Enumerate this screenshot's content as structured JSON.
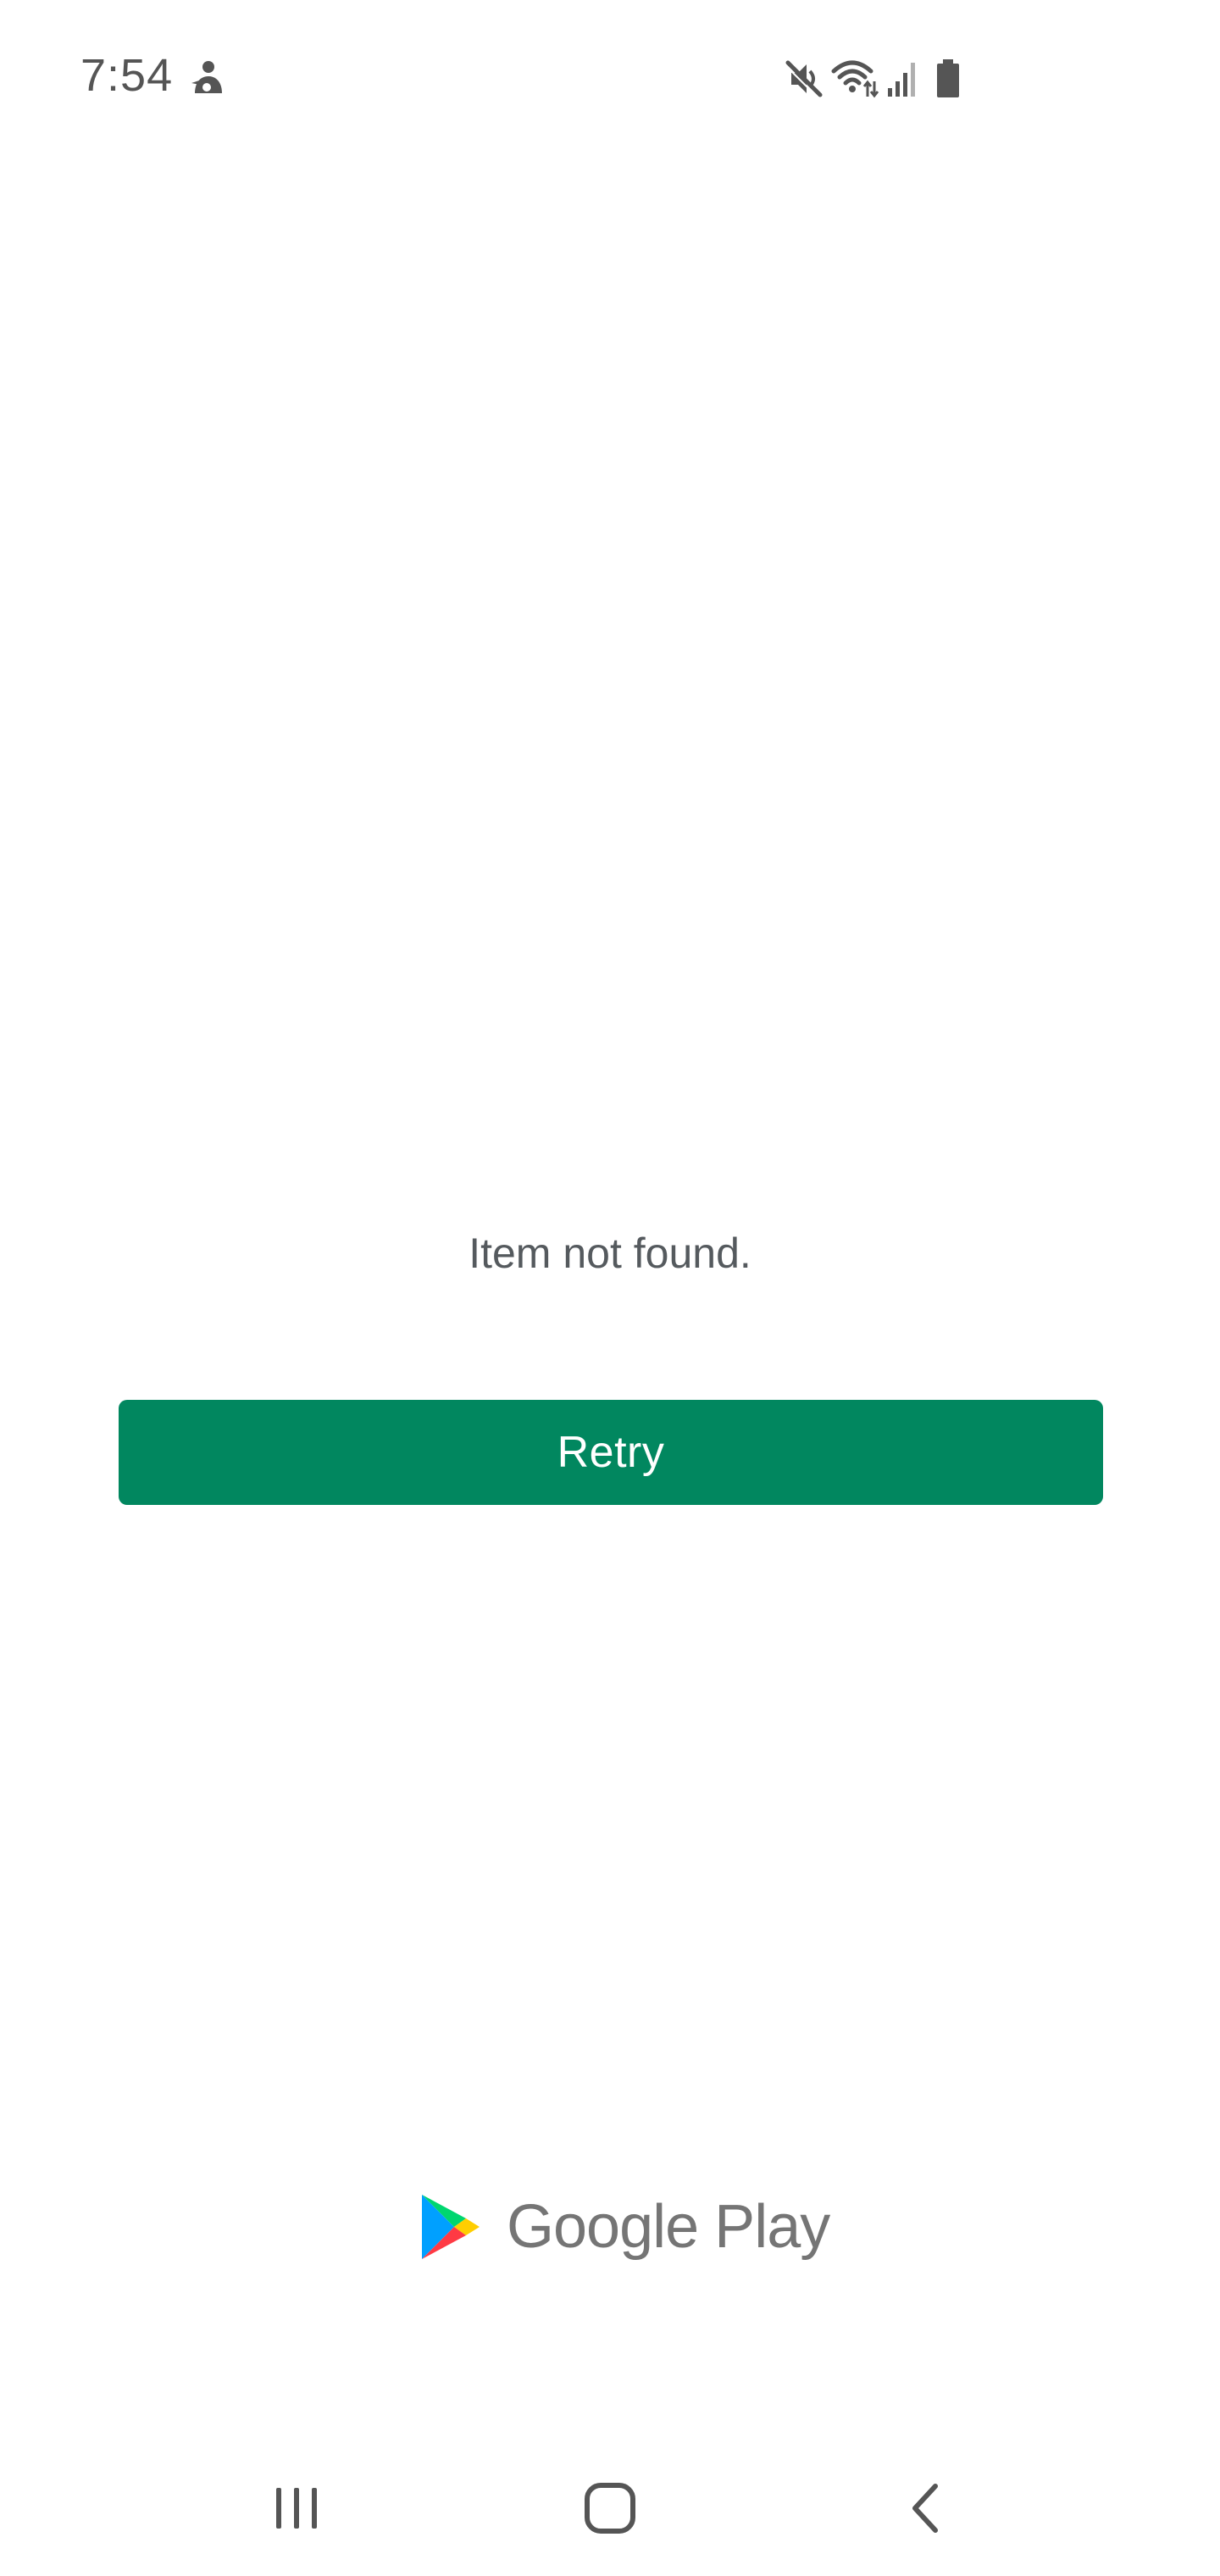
{
  "status_bar": {
    "time": "7:54",
    "icons": [
      "accessibility-person-icon",
      "mute-icon",
      "wifi-icon",
      "cell-signal-icon",
      "battery-icon"
    ]
  },
  "main": {
    "message": "Item not found.",
    "retry_label": "Retry",
    "retry_color": "#01875f"
  },
  "footer": {
    "brand_logo": "google-play-icon",
    "brand_text": "Google Play"
  },
  "nav_bar": {
    "buttons": [
      "recent-apps-icon",
      "home-icon",
      "back-icon"
    ]
  }
}
